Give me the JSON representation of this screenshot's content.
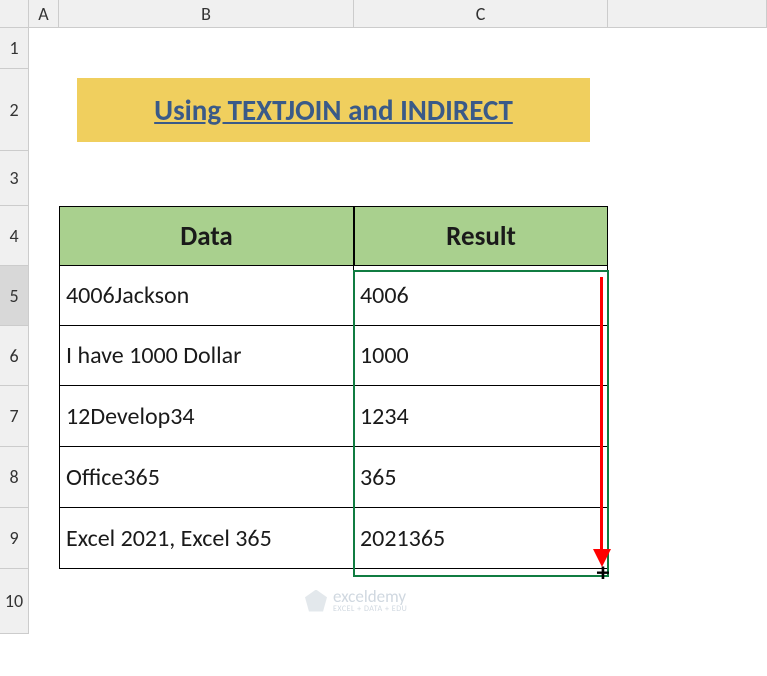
{
  "columns": [
    "A",
    "B",
    "C"
  ],
  "rows": [
    "1",
    "2",
    "3",
    "4",
    "5",
    "6",
    "7",
    "8",
    "9",
    "10"
  ],
  "title": "Using TEXTJOIN and INDIRECT",
  "headers": {
    "data": "Data",
    "result": "Result"
  },
  "table": [
    {
      "data": "4006Jackson",
      "result": "4006"
    },
    {
      "data": "I have 1000 Dollar",
      "result": "1000"
    },
    {
      "data": "12Develop34",
      "result": "1234"
    },
    {
      "data": "Office365",
      "result": "365"
    },
    {
      "data": "Excel 2021, Excel 365",
      "result": "2021365"
    }
  ],
  "watermark": {
    "name": "exceldemy",
    "tagline": "EXCEL + DATA + EDU"
  }
}
